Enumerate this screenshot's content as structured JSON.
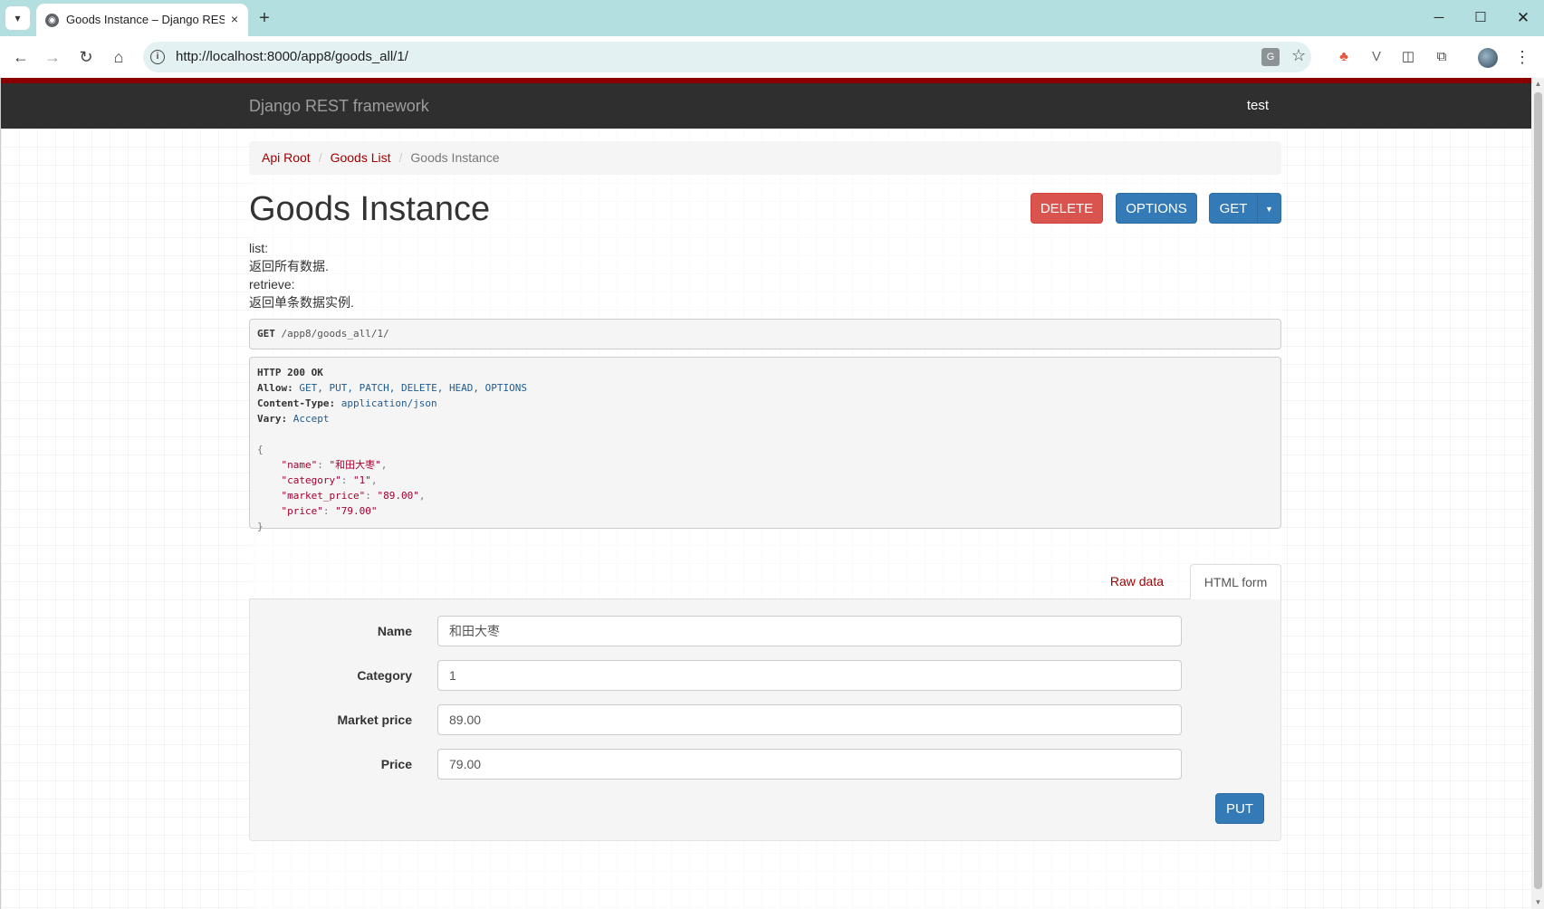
{
  "browser": {
    "tab_title": "Goods Instance – Django REST framework",
    "tab_favicon": "globe-icon",
    "url": "http://localhost:8000/app8/goods_all/1/",
    "icons": {
      "tab_menu": "▾",
      "close": "×",
      "new_tab": "+",
      "minimize": "─",
      "maximize": "☐",
      "window_close": "✕",
      "back": "←",
      "forward": "→",
      "reload": "↻",
      "home": "⌂",
      "site_info": "i",
      "translate": "G",
      "bookmark": "☆",
      "ext_a": "♣",
      "ext_v": "V",
      "ext_b": "◫",
      "ext_puzzle": "⧉",
      "menu": "⋮"
    }
  },
  "navbar": {
    "brand": "Django REST framework",
    "user": "test"
  },
  "breadcrumb": {
    "items": [
      "Api Root",
      "Goods List",
      "Goods Instance"
    ],
    "separator": "/"
  },
  "page": {
    "title": "Goods Instance",
    "buttons": {
      "delete": "DELETE",
      "options": "OPTIONS",
      "get": "GET",
      "get_caret": "▼"
    },
    "description": [
      "list:",
      "返回所有数据.",
      "retrieve:",
      "返回单条数据实例."
    ]
  },
  "request": {
    "method": "GET",
    "path": "/app8/goods_all/1/"
  },
  "response": {
    "status": "HTTP 200 OK",
    "headers": [
      {
        "name": "Allow:",
        "value": "GET, PUT, PATCH, DELETE, HEAD, OPTIONS"
      },
      {
        "name": "Content-Type:",
        "value": "application/json"
      },
      {
        "name": "Vary:",
        "value": "Accept"
      }
    ],
    "body": [
      {
        "key": "\"name\"",
        "value": "\"和田大枣\""
      },
      {
        "key": "\"category\"",
        "value": "\"1\""
      },
      {
        "key": "\"market_price\"",
        "value": "\"89.00\""
      },
      {
        "key": "\"price\"",
        "value": "\"79.00\""
      }
    ]
  },
  "form": {
    "tabs": {
      "raw": "Raw data",
      "html": "HTML form"
    },
    "fields": [
      {
        "label": "Name",
        "value": "和田大枣"
      },
      {
        "label": "Category",
        "value": "1"
      },
      {
        "label": "Market price",
        "value": "89.00"
      },
      {
        "label": "Price",
        "value": "79.00"
      }
    ],
    "submit": "PUT"
  },
  "colors": {
    "brand_red": "#a30000",
    "primary_blue": "#337ab7",
    "danger_red": "#d9534f",
    "navbar_bg": "#2f2f2f"
  }
}
